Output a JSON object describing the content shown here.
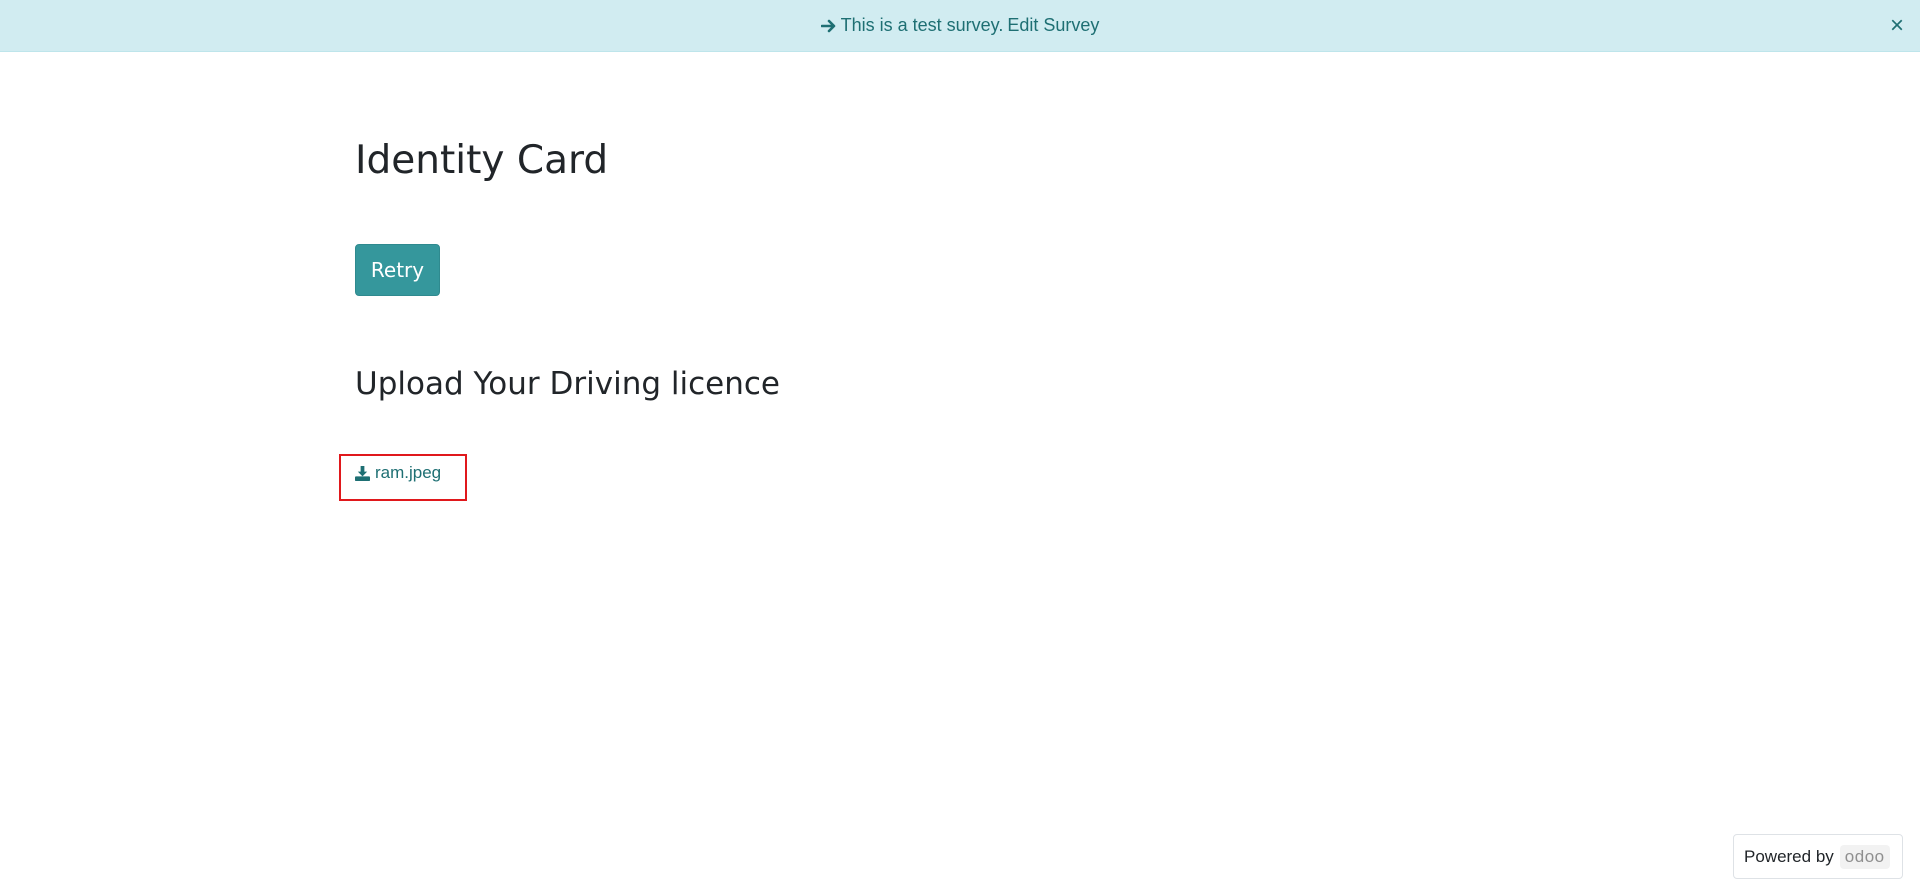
{
  "banner": {
    "message": "This is a test survey.",
    "link_label": "Edit Survey",
    "close_symbol": "×",
    "arrow_icon": "arrow-right-icon"
  },
  "survey": {
    "title": "Identity Card",
    "retry_label": "Retry"
  },
  "question": {
    "title": "Upload Your Driving licence",
    "file_name": "ram.jpeg",
    "file_icon": "download-icon"
  },
  "footer": {
    "powered_by": "Powered by",
    "brand": "odoo"
  },
  "colors": {
    "banner_bg": "#d1ecf1",
    "banner_text": "#1e6f73",
    "primary": "#35979c",
    "highlight_box": "#e0181c"
  }
}
